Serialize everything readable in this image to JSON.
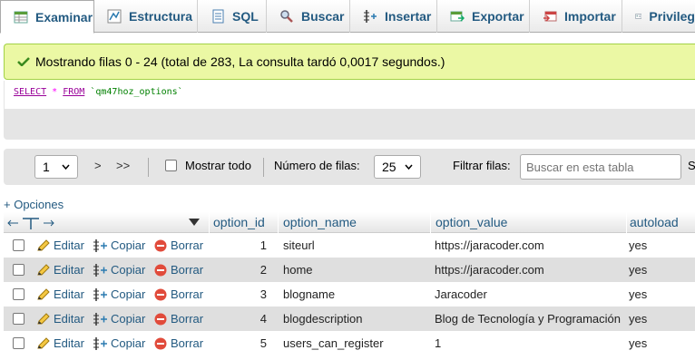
{
  "tabs": [
    {
      "label": "Examinar",
      "icon": "browse-icon"
    },
    {
      "label": "Estructura",
      "icon": "structure-icon"
    },
    {
      "label": "SQL",
      "icon": "sql-icon"
    },
    {
      "label": "Buscar",
      "icon": "search-icon"
    },
    {
      "label": "Insertar",
      "icon": "insert-icon"
    },
    {
      "label": "Exportar",
      "icon": "export-icon"
    },
    {
      "label": "Importar",
      "icon": "import-icon"
    },
    {
      "label": "Privileg",
      "icon": "privileges-icon"
    }
  ],
  "message": "Mostrando filas 0 - 24 (total de 283, La consulta tardó 0,0017 segundos.)",
  "query": {
    "select": "SELECT",
    "star": "*",
    "from": "FROM",
    "table": "`qm47hoz_options`"
  },
  "nav": {
    "page": "1",
    "next": ">",
    "last": ">>",
    "show_all": "Mostrar todo",
    "rows_label": "Número de filas:",
    "rows_value": "25",
    "filter_label": "Filtrar filas:",
    "filter_placeholder": "Buscar en esta tabla",
    "cut_text": "S"
  },
  "options_link": "+ Opciones",
  "columns": [
    "option_id",
    "option_name",
    "option_value",
    "autoload"
  ],
  "actions": {
    "edit": "Editar",
    "copy": "Copiar",
    "delete": "Borrar"
  },
  "rows": [
    {
      "option_id": "1",
      "option_name": "siteurl",
      "option_value": "https://jaracoder.com",
      "autoload": "yes"
    },
    {
      "option_id": "2",
      "option_name": "home",
      "option_value": "https://jaracoder.com",
      "autoload": "yes"
    },
    {
      "option_id": "3",
      "option_name": "blogname",
      "option_value": "Jaracoder",
      "autoload": "yes"
    },
    {
      "option_id": "4",
      "option_name": "blogdescription",
      "option_value": "Blog de Tecnología y Programación",
      "autoload": "yes"
    },
    {
      "option_id": "5",
      "option_name": "users_can_register",
      "option_value": "1",
      "autoload": "yes"
    }
  ],
  "colors": {
    "link": "#235a81",
    "success_bg": "#ebf8a4",
    "success_border": "#a2d246",
    "even_row": "#dfdfdf"
  }
}
